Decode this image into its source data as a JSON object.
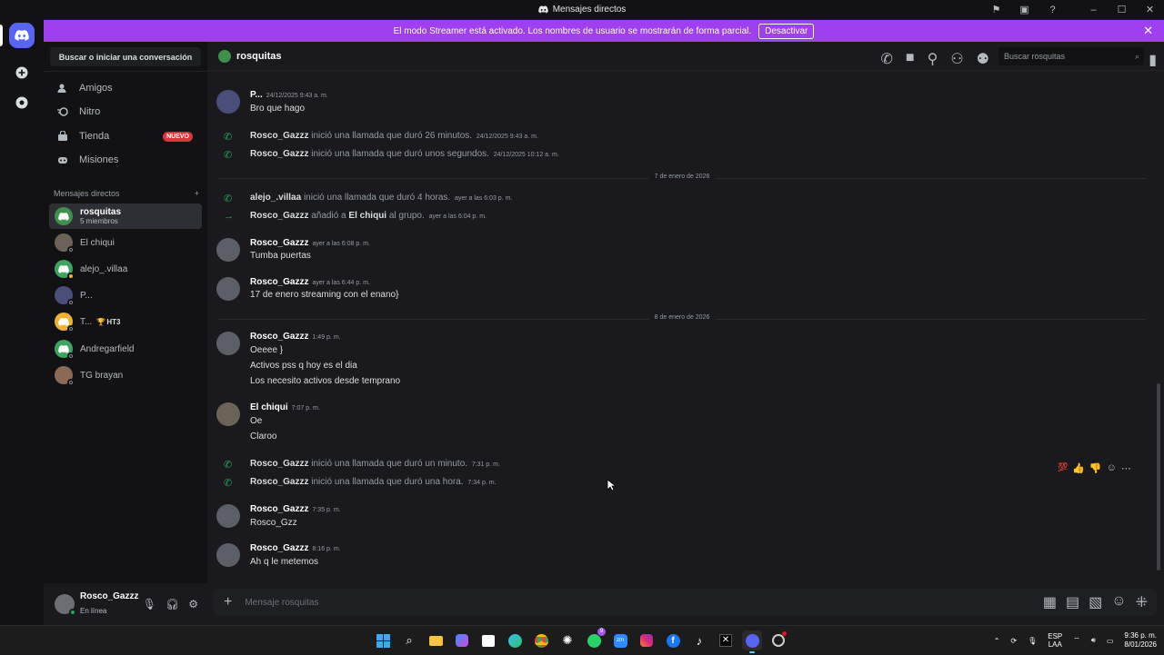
{
  "window": {
    "title": "Mensajes directos"
  },
  "banner": {
    "text": "El modo Streamer está activado. Los nombres de usuario se mostrarán de forma parcial.",
    "button": "Desactivar"
  },
  "sidebar": {
    "search": "Buscar o iniciar una conversación",
    "nav": [
      {
        "label": "Amigos",
        "icon": "friends-icon"
      },
      {
        "label": "Nitro",
        "icon": "nitro-icon"
      },
      {
        "label": "Tienda",
        "icon": "shop-icon",
        "badge": "NUEVO"
      },
      {
        "label": "Misiones",
        "icon": "quests-icon"
      }
    ],
    "dm_header": "Mensajes directos",
    "dms": [
      {
        "name": "rosquitas",
        "sub": "5 miembros"
      },
      {
        "name": "El chiqui"
      },
      {
        "name": "alejo_.villaa"
      },
      {
        "name": "P..."
      },
      {
        "name": "T...",
        "tag": "HT3"
      },
      {
        "name": "Andregarfield"
      },
      {
        "name": "TG brayan"
      }
    ]
  },
  "user": {
    "name": "Rosco_Gazzz",
    "status": "En línea"
  },
  "chat": {
    "channel": "rosquitas",
    "search_placeholder": "Buscar rosquitas",
    "composer_placeholder": "Mensaje rosquitas"
  },
  "messages": {
    "m1": {
      "author": "P...",
      "ts": "24/12/2025 9:43 a. m.",
      "lines": [
        "Bro que hago"
      ]
    },
    "s1": {
      "author": "Rosco_Gazzz",
      "text": "inició una llamada que duró 26 minutos.",
      "ts": "24/12/2025 9:43 a. m."
    },
    "s2": {
      "author": "Rosco_Gazzz",
      "text": "inició una llamada que duró unos segundos.",
      "ts": "24/12/2025 10:12 a. m."
    },
    "d1": "7 de enero de 2026",
    "s3": {
      "author": "alejo_.villaa",
      "text": "inició una llamada que duró 4 horas.",
      "ts": "ayer a las 6:03 p. m."
    },
    "s4": {
      "author": "Rosco_Gazzz",
      "pre": "añadió a",
      "target": "El chiqui",
      "post": "al grupo.",
      "ts": "ayer a las 6:04 p. m."
    },
    "m2": {
      "author": "Rosco_Gazzz",
      "ts": "ayer a las 6:08 p. m.",
      "lines": [
        "Tumba puertas"
      ]
    },
    "m3": {
      "author": "Rosco_Gazzz",
      "ts": "ayer a las 6:44 p. m.",
      "lines": [
        "17 de enero streaming con el enano}"
      ]
    },
    "d2": "8 de enero de 2026",
    "m4": {
      "author": "Rosco_Gazzz",
      "ts": "1:49 p. m.",
      "lines": [
        "Oeeee }",
        "Activos pss q hoy es el dia",
        "Los necesito activos desde temprano"
      ]
    },
    "m5": {
      "author": "El chiqui",
      "ts": "7:07 p. m.",
      "lines": [
        "Oe",
        "Claroo"
      ]
    },
    "s5": {
      "author": "Rosco_Gazzz",
      "text": "inició una llamada que duró un minuto.",
      "ts": "7:31 p. m."
    },
    "s6": {
      "author": "Rosco_Gazzz",
      "text": "inició una llamada que duró una hora.",
      "ts": "7:34 p. m."
    },
    "m6": {
      "author": "Rosco_Gazzz",
      "ts": "7:35 p. m.",
      "lines": [
        "Rosco_Gzz"
      ]
    },
    "m7": {
      "author": "Rosco_Gazzz",
      "ts": "8:16 p. m.",
      "lines": [
        "Ah q le metemos"
      ]
    }
  },
  "taskbar": {
    "lang": "ESP",
    "region": "LAA",
    "time": "9:36 p. m.",
    "date": "8/01/2026",
    "whatsapp_badge": "9"
  },
  "colors": {
    "accent": "#5865f2",
    "banner": "#9e3ff0",
    "online": "#23a55a",
    "call": "#23a55a"
  }
}
